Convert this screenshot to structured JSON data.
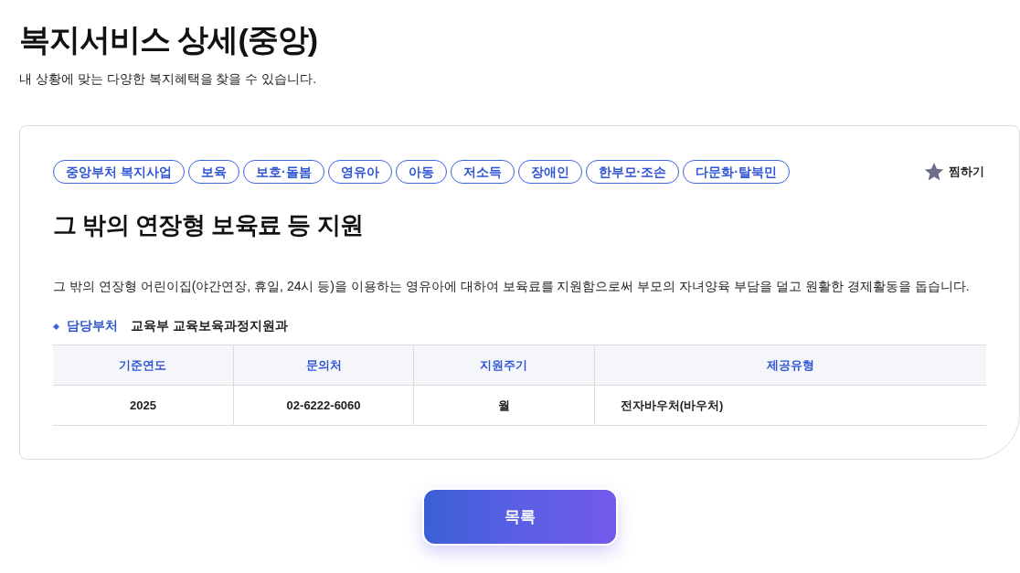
{
  "page": {
    "title": "복지서비스 상세(중앙)",
    "subtitle": "내 상황에 맞는 다양한 복지혜택을 찾을 수 있습니다."
  },
  "service": {
    "tags": [
      "중앙부처 복지사업",
      "보육",
      "보호·돌봄",
      "영유아",
      "아동",
      "저소득",
      "장애인",
      "한부모·조손",
      "다문화·탈북민"
    ],
    "favorite": {
      "label": "찜하기"
    },
    "title": "그 밖의 연장형 보육료 등 지원",
    "description": "그 밖의 연장형 어린이집(야간연장, 휴일, 24시 등)을 이용하는 영유아에 대하여 보육료를 지원함으로써 부모의 자녀양육 부담을 덜고 원활한 경제활동을 돕습니다.",
    "department": {
      "label": "담당부처",
      "value": "교육부 교육보육과정지원과"
    },
    "table": {
      "columns": [
        "기준연도",
        "문의처",
        "지원주기",
        "제공유형"
      ],
      "rows": [
        [
          "2025",
          "02-6222-6060",
          "월",
          "전자바우처(바우처)"
        ]
      ]
    }
  },
  "list_button": {
    "label": "목록"
  }
}
